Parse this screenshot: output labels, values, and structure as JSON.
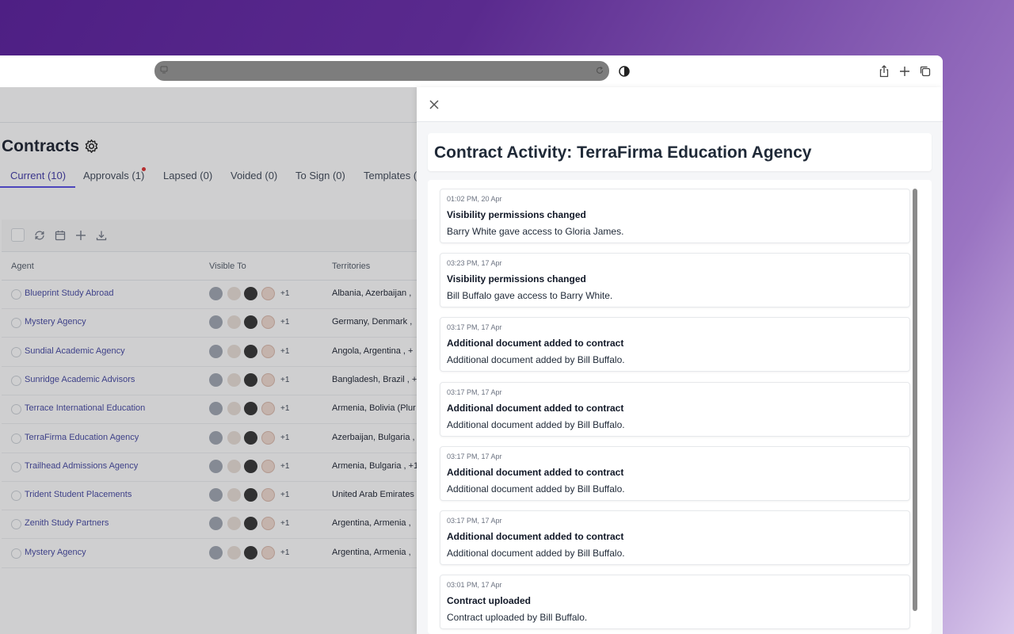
{
  "page": {
    "title": "Contracts",
    "tabs": [
      {
        "label": "Current (10)",
        "active": true
      },
      {
        "label": "Approvals (1)",
        "has_badge": true
      },
      {
        "label": "Lapsed (0)"
      },
      {
        "label": "Voided (0)"
      },
      {
        "label": "To Sign (0)"
      },
      {
        "label": "Templates (("
      }
    ],
    "columns": {
      "agent": "Agent",
      "visible_to": "Visible To",
      "territories": "Territories"
    },
    "rows": [
      {
        "agent": "Blueprint Study Abroad",
        "more": "+1",
        "territories": "Albania, Azerbaijan ,"
      },
      {
        "agent": "Mystery Agency",
        "more": "+1",
        "territories": "Germany, Denmark ,"
      },
      {
        "agent": "Sundial Academic Agency",
        "more": "+1",
        "territories": "Angola, Argentina , +"
      },
      {
        "agent": "Sunridge Academic Advisors",
        "more": "+1",
        "territories": "Bangladesh, Brazil , +"
      },
      {
        "agent": "Terrace International Education",
        "more": "+1",
        "territories": "Armenia, Bolivia (Plur"
      },
      {
        "agent": "TerraFirma Education Agency",
        "more": "+1",
        "territories": "Azerbaijan, Bulgaria ,"
      },
      {
        "agent": "Trailhead Admissions Agency",
        "more": "+1",
        "territories": "Armenia, Bulgaria , +1"
      },
      {
        "agent": "Trident Student Placements",
        "more": "+1",
        "territories": "United Arab Emirates"
      },
      {
        "agent": "Zenith Study Partners",
        "more": "+1",
        "territories": "Argentina, Armenia ,"
      },
      {
        "agent": "Mystery Agency",
        "more": "+1",
        "territories": "Argentina, Armenia ,"
      }
    ]
  },
  "panel": {
    "title": "Contract Activity: TerraFirma Education Agency",
    "activities": [
      {
        "time": "01:02 PM, 20 Apr",
        "title": "Visibility permissions changed",
        "desc": "Barry White gave access to Gloria James."
      },
      {
        "time": "03:23 PM, 17 Apr",
        "title": "Visibility permissions changed",
        "desc": "Bill Buffalo gave access to Barry White."
      },
      {
        "time": "03:17 PM, 17 Apr",
        "title": "Additional document added to contract",
        "desc": "Additional document added by Bill Buffalo."
      },
      {
        "time": "03:17 PM, 17 Apr",
        "title": "Additional document added to contract",
        "desc": "Additional document added by Bill Buffalo."
      },
      {
        "time": "03:17 PM, 17 Apr",
        "title": "Additional document added to contract",
        "desc": "Additional document added by Bill Buffalo."
      },
      {
        "time": "03:17 PM, 17 Apr",
        "title": "Additional document added to contract",
        "desc": "Additional document added by Bill Buffalo."
      },
      {
        "time": "03:01 PM, 17 Apr",
        "title": "Contract uploaded",
        "desc": "Contract uploaded by Bill Buffalo."
      }
    ]
  },
  "icons": {
    "site": "site-info-icon",
    "reload": "reload-icon",
    "shield": "privacy-shield-icon",
    "share": "share-icon",
    "new_tab": "plus-icon",
    "tabs": "tabs-overview-icon",
    "gear": "gear-icon",
    "refresh": "refresh-icon",
    "calendar": "calendar-icon",
    "add": "plus-icon",
    "download": "download-icon",
    "close": "close-icon"
  },
  "colors": {
    "accent": "#4f46e5",
    "badge": "#dc2626",
    "link": "#3b3f9e"
  }
}
